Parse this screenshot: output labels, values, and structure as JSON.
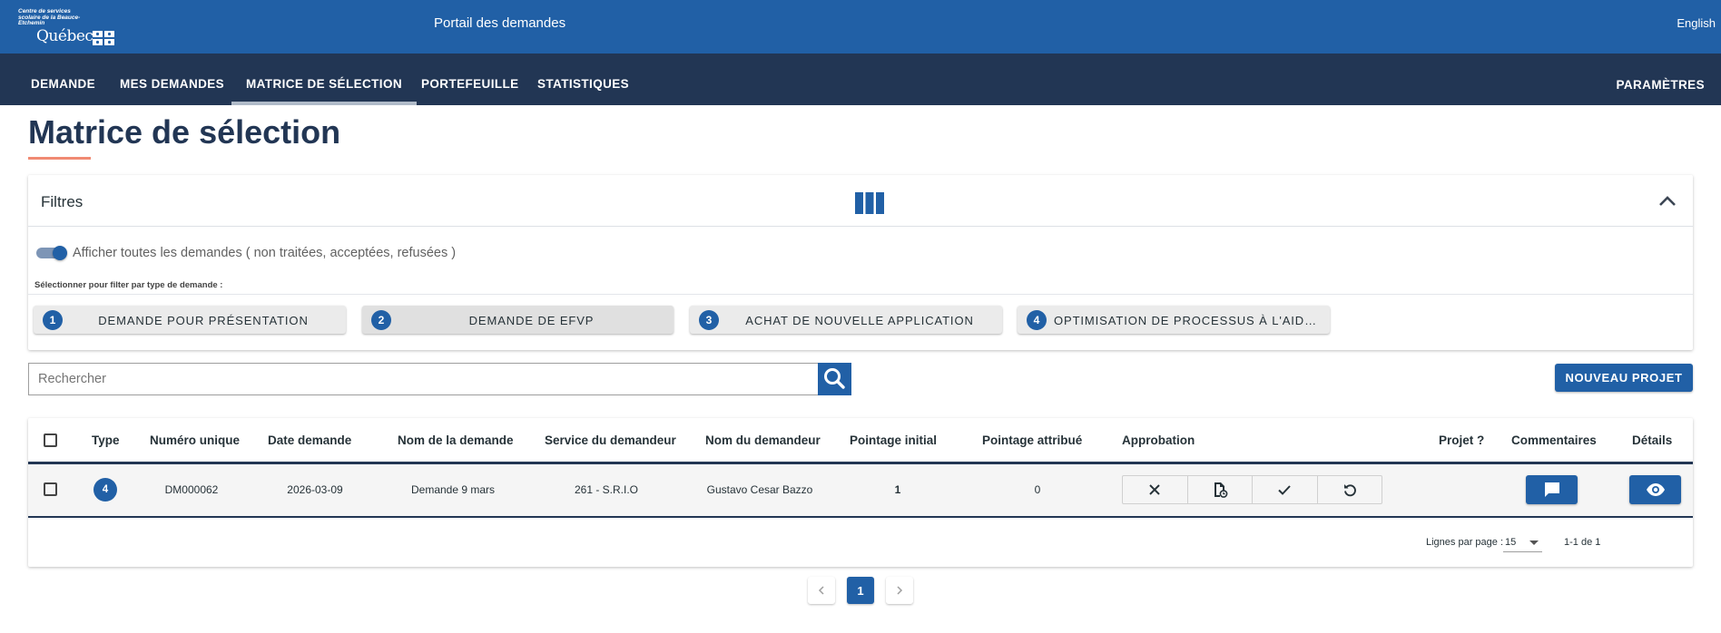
{
  "header": {
    "logo_org": "Centre de services scolaire de la Beauce-Etchemin",
    "logo_brand": "Québec",
    "portal_title": "Portail des demandes",
    "language_link": "English"
  },
  "nav": {
    "items": [
      {
        "label": "DEMANDE"
      },
      {
        "label": "MES DEMANDES"
      },
      {
        "label": "MATRICE DE SÉLECTION",
        "active": true
      },
      {
        "label": "PORTEFEUILLE"
      },
      {
        "label": "STATISTIQUES"
      }
    ],
    "settings": "PARAMÈTRES"
  },
  "page": {
    "title": "Matrice de sélection"
  },
  "filters": {
    "title": "Filtres",
    "toggle_label": "Afficher toutes les demandes ( non traitées, acceptées, refusées )",
    "toggle_on": true,
    "type_hint": "Sélectionner pour filter par type de demande :",
    "types": [
      {
        "number": "1",
        "label": "DEMANDE POUR PRÉSENTATION"
      },
      {
        "number": "2",
        "label": "DEMANDE DE EFVP"
      },
      {
        "number": "3",
        "label": "ACHAT DE NOUVELLE APPLICATION"
      },
      {
        "number": "4",
        "label": "OPTIMISATION DE PROCESSUS À L'AIDE …"
      }
    ]
  },
  "search": {
    "placeholder": "Rechercher",
    "value": ""
  },
  "new_project_label": "NOUVEAU PROJET",
  "table": {
    "headers": {
      "type": "Type",
      "unique_number": "Numéro unique",
      "request_date": "Date demande",
      "request_name": "Nom de la demande",
      "requester_service": "Service du demandeur",
      "requester_name": "Nom du demandeur",
      "initial_score": "Pointage initial",
      "assigned_score": "Pointage attribué",
      "approval": "Approbation",
      "project": "Projet ?",
      "comments": "Commentaires",
      "details": "Détails"
    },
    "rows": [
      {
        "type": "4",
        "unique_number": "DM000062",
        "request_date": "2026-03-09",
        "request_name": "Demande 9 mars",
        "requester_service": "261 - S.R.I.O",
        "requester_name": "Gustavo Cesar Bazzo",
        "initial_score": "1",
        "assigned_score": "0"
      }
    ],
    "rows_per_page_label": "Lignes par page :",
    "rows_per_page_value": "15",
    "range_label": "1-1 de 1"
  },
  "pagination": {
    "current_page": "1"
  },
  "colors": {
    "brand_blue": "#2160a6",
    "nav_navy": "#223654",
    "accent_salmon": "#f08a73"
  }
}
